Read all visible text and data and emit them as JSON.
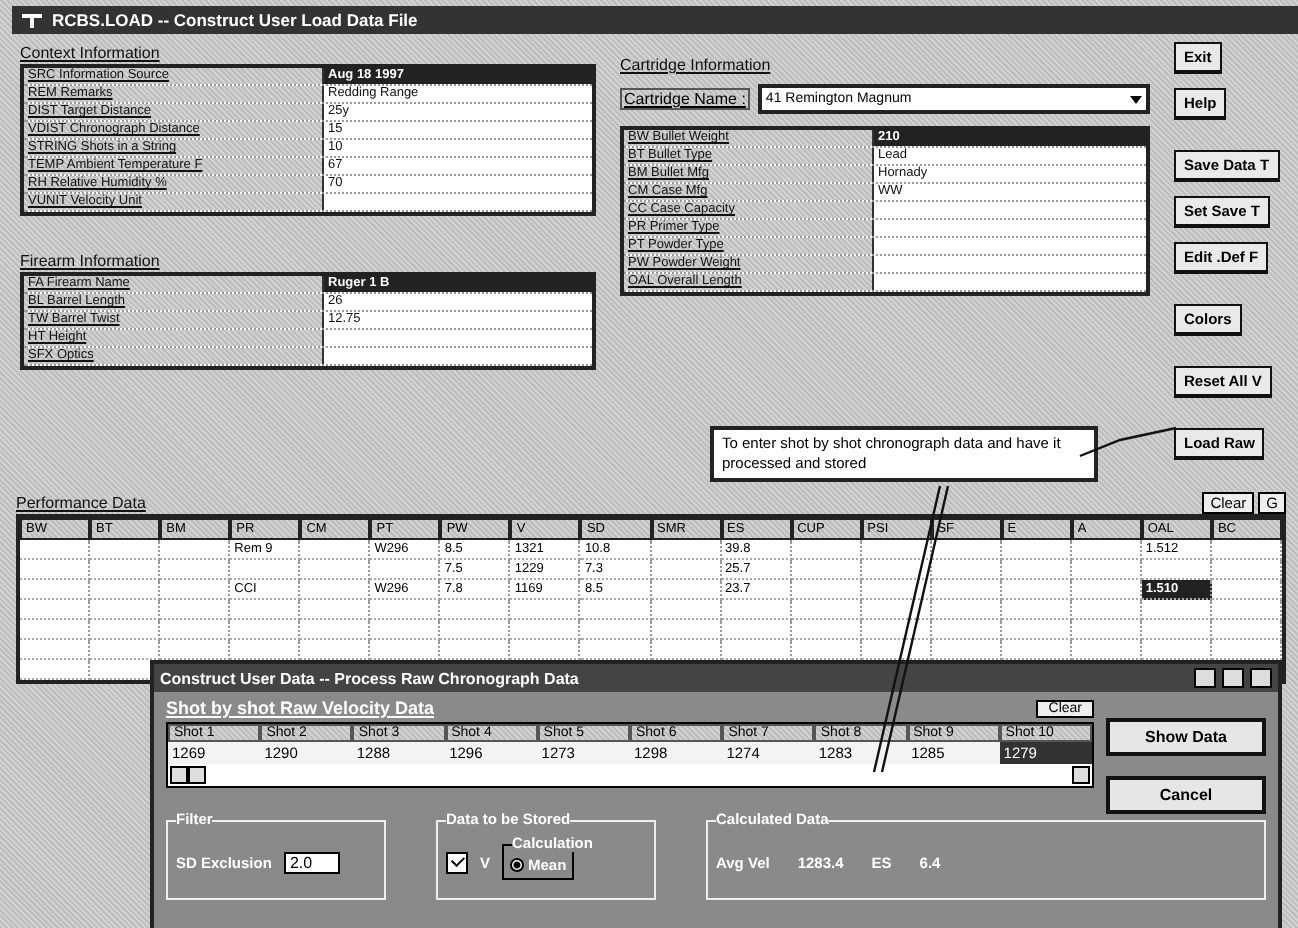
{
  "window": {
    "title": "RCBS.LOAD -- Construct User Load Data File"
  },
  "context": {
    "title": "Context Information",
    "rows": [
      {
        "label": "SRC Information Source",
        "value": "Aug 18 1997",
        "selected": true
      },
      {
        "label": "REM Remarks",
        "value": "Redding Range",
        "selected": false
      },
      {
        "label": "DIST Target Distance",
        "value": "25y",
        "selected": false
      },
      {
        "label": "VDIST Chronograph Distance",
        "value": "15",
        "selected": false
      },
      {
        "label": "STRING Shots in a String",
        "value": "10",
        "selected": false
      },
      {
        "label": "TEMP Ambient Temperature F",
        "value": "67",
        "selected": false
      },
      {
        "label": "RH Relative Humidity %",
        "value": "70",
        "selected": false
      },
      {
        "label": "VUNIT Velocity Unit",
        "selected": false
      }
    ]
  },
  "firearm": {
    "title": "Firearm Information",
    "rows": [
      {
        "label": "FA Firearm Name",
        "value": "Ruger 1 B",
        "selected": true
      },
      {
        "label": "BL Barrel Length",
        "value": "26",
        "selected": false
      },
      {
        "label": "TW Barrel Twist",
        "value": "12.75",
        "selected": false
      },
      {
        "label": "HT Height",
        "selected": false
      },
      {
        "label": "SFX Optics",
        "selected": false
      }
    ]
  },
  "cartridge": {
    "title": "Cartridge Information",
    "name_label": "Cartridge Name :",
    "name_value": "41 Remington Magnum",
    "rows": [
      {
        "label": "BW Bullet Weight",
        "value": "210",
        "selected": true
      },
      {
        "label": "BT Bullet Type",
        "value": "Lead",
        "selected": false
      },
      {
        "label": "BM Bullet Mfg",
        "value": "Hornady",
        "selected": false
      },
      {
        "label": "CM Case Mfg",
        "value": "WW",
        "selected": false
      },
      {
        "label": "CC Case Capacity",
        "selected": false
      },
      {
        "label": "PR Primer Type",
        "selected": false
      },
      {
        "label": "PT Powder Type",
        "selected": false
      },
      {
        "label": "PW Powder Weight",
        "selected": false
      },
      {
        "label": "OAL Overall Length",
        "selected": false
      }
    ]
  },
  "side_buttons": [
    "Exit",
    "Help",
    "Save Data T",
    "Set Save T",
    "Edit .Def F",
    "Colors",
    "Reset All V",
    "Load Raw"
  ],
  "callout": "To enter shot by shot chronograph data and have it processed and stored",
  "performance": {
    "title": "Performance Data",
    "buttons": [
      "Clear",
      "G"
    ],
    "columns": [
      "BW",
      "BT",
      "BM",
      "PR",
      "CM",
      "PT",
      "PW",
      "V",
      "SD",
      "SMR",
      "ES",
      "CUP",
      "PSI",
      "SF",
      "E",
      "A",
      "OAL",
      "BC"
    ],
    "rows": [
      {
        "cells": [
          {
            "selected": false
          },
          {
            "selected": false
          },
          {
            "selected": false
          },
          {
            "text": "Rem 9",
            "selected": false
          },
          {
            "selected": false
          },
          {
            "text": "W296",
            "selected": false
          },
          {
            "text": "8.5",
            "selected": false
          },
          {
            "text": "1321",
            "selected": false
          },
          {
            "text": "10.8",
            "selected": false
          },
          {
            "selected": false
          },
          {
            "text": "39.8",
            "selected": false
          },
          {
            "selected": false
          },
          {
            "selected": false
          },
          {
            "selected": false
          },
          {
            "selected": false
          },
          {
            "selected": false
          },
          {
            "text": "1.512",
            "selected": false
          },
          {
            "selected": false
          }
        ]
      },
      {
        "cells": [
          {
            "selected": false
          },
          {
            "selected": false
          },
          {
            "selected": false
          },
          {
            "selected": false
          },
          {
            "selected": false
          },
          {
            "selected": false
          },
          {
            "text": "7.5",
            "selected": false
          },
          {
            "text": "1229",
            "selected": false
          },
          {
            "text": "7.3",
            "selected": false
          },
          {
            "selected": false
          },
          {
            "text": "25.7",
            "selected": false
          },
          {
            "selected": false
          },
          {
            "selected": false
          },
          {
            "selected": false
          },
          {
            "selected": false
          },
          {
            "selected": false
          },
          {
            "selected": false
          },
          {
            "selected": false
          }
        ]
      },
      {
        "cells": [
          {
            "selected": false
          },
          {
            "selected": false
          },
          {
            "selected": false
          },
          {
            "text": "CCI",
            "selected": false
          },
          {
            "selected": false
          },
          {
            "text": "W296",
            "selected": false
          },
          {
            "text": "7.8",
            "selected": false
          },
          {
            "text": "1169",
            "selected": false
          },
          {
            "text": "8.5",
            "selected": false
          },
          {
            "selected": false
          },
          {
            "text": "23.7",
            "selected": false
          },
          {
            "selected": false
          },
          {
            "selected": false
          },
          {
            "selected": false
          },
          {
            "selected": false
          },
          {
            "selected": false
          },
          {
            "text": "1.510",
            "selected": true
          },
          {
            "selected": false
          }
        ]
      }
    ]
  },
  "dialog": {
    "title": "Construct User Data -- Process Raw Chronograph Data",
    "heading": "Shot by shot Raw Velocity Data",
    "clear": "Clear",
    "buttons": [
      "Show Data",
      "Cancel"
    ],
    "shots": [
      {
        "label": "Shot 1",
        "value": "1269",
        "selected": false
      },
      {
        "label": "Shot 2",
        "value": "1290",
        "selected": false
      },
      {
        "label": "Shot 3",
        "value": "1288",
        "selected": false
      },
      {
        "label": "Shot 4",
        "value": "1296",
        "selected": false
      },
      {
        "label": "Shot 5",
        "value": "1273",
        "selected": false
      },
      {
        "label": "Shot 6",
        "value": "1298",
        "selected": false
      },
      {
        "label": "Shot 7",
        "value": "1274",
        "selected": false
      },
      {
        "label": "Shot 8",
        "value": "1283",
        "selected": false
      },
      {
        "label": "Shot 9",
        "value": "1285",
        "selected": false
      },
      {
        "label": "Shot 10",
        "value": "1279",
        "selected": true
      }
    ],
    "filter": {
      "title": "Filter",
      "label": "SD Exclusion",
      "value": "2.0"
    },
    "stored": {
      "title": "Data to be Stored",
      "check_label": "V",
      "checked": true,
      "box_title": "Calculation",
      "options": [
        {
          "label": "Mean",
          "selected": true
        }
      ]
    },
    "calculated": {
      "title": "Calculated Data",
      "items": [
        {
          "label": "Avg Vel",
          "value": "1283.4"
        },
        {
          "label": "ES",
          "value": "6.4"
        }
      ]
    }
  }
}
